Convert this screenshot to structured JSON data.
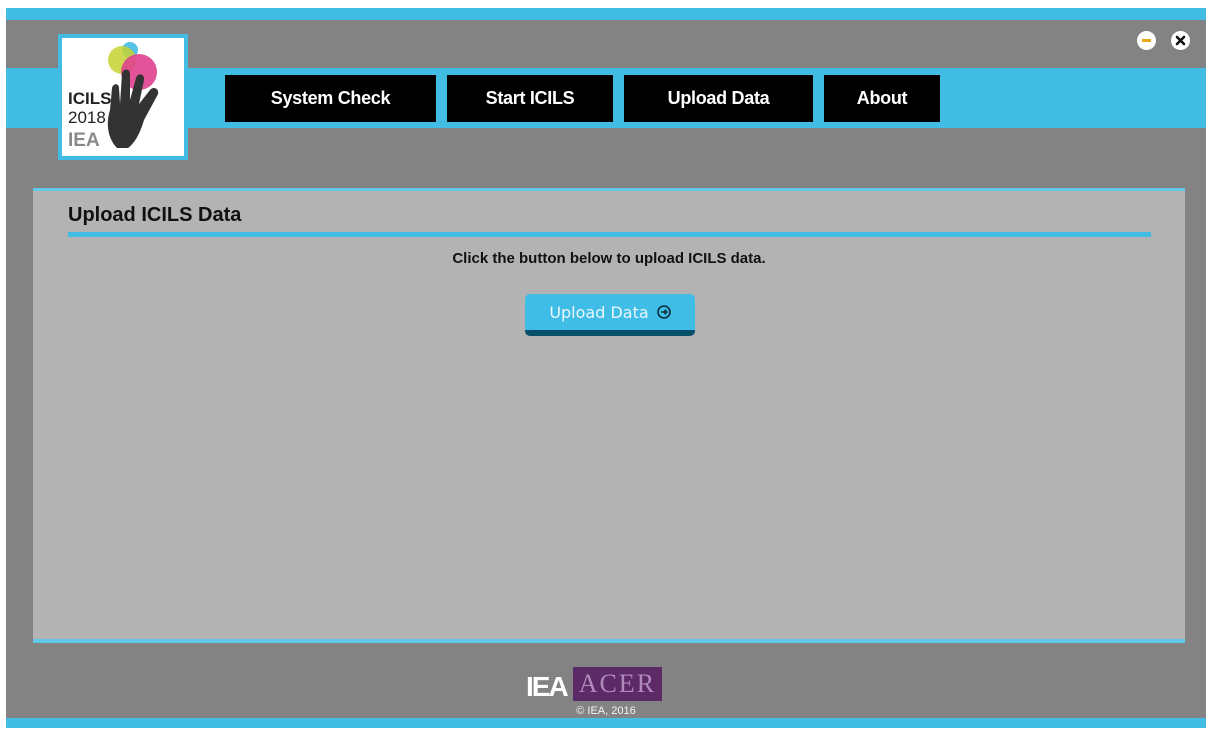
{
  "nav": {
    "items": [
      {
        "label": "System Check"
      },
      {
        "label": "Start ICILS"
      },
      {
        "label": "Upload Data"
      },
      {
        "label": "About"
      }
    ]
  },
  "logo": {
    "line1": "ICILS",
    "line2": "2018",
    "line3": "IEA"
  },
  "window_controls": {
    "minimize_icon": "minimize-icon",
    "close_icon": "close-icon"
  },
  "panel": {
    "title": "Upload ICILS Data",
    "instruction": "Click the button below to upload ICILS data.",
    "upload_button_label": "Upload Data",
    "upload_button_icon": "arrow-circle-icon"
  },
  "footer": {
    "iea_logo": "IEA",
    "acer_logo": "ACER",
    "copyright": "© IEA, 2016"
  },
  "colors": {
    "accent_blue": "#41bde3",
    "frame_gray": "#838383",
    "panel_gray": "#b3b3b3",
    "nav_button_bg": "#000000",
    "acer_purple": "#5c2a66"
  }
}
